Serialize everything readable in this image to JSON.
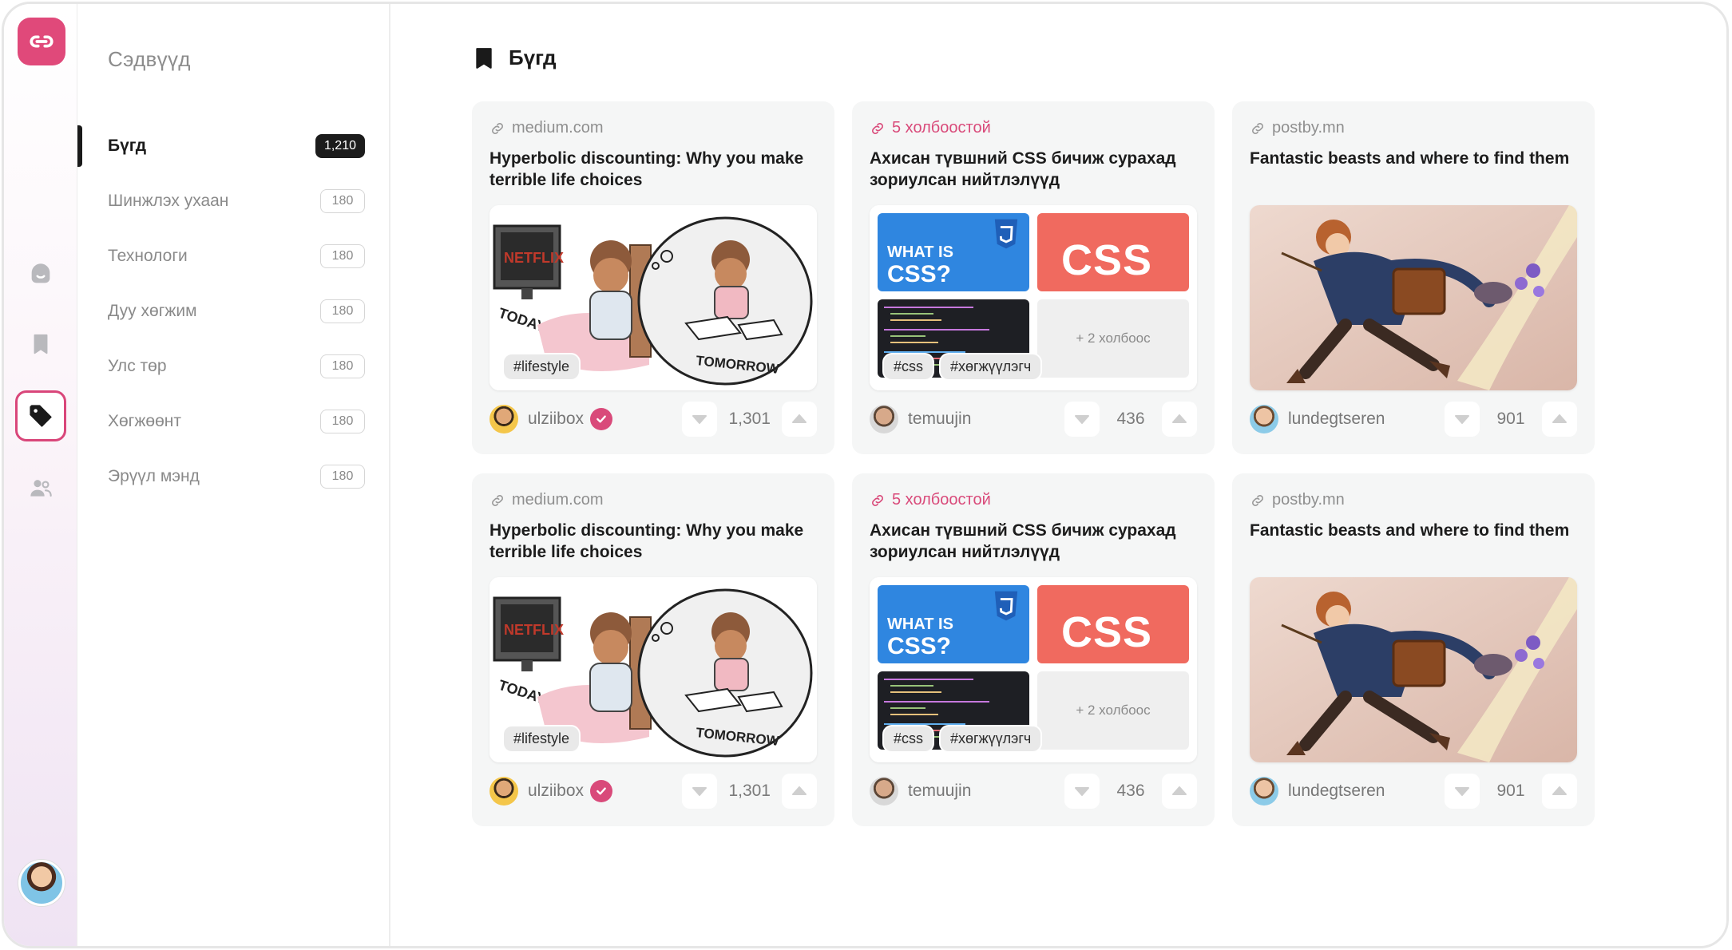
{
  "sidebar": {
    "title": "Сэдвүүд",
    "categories": [
      {
        "label": "Бүгд",
        "count": "1,210",
        "active": true
      },
      {
        "label": "Шинжлэх ухаан",
        "count": "180"
      },
      {
        "label": "Технологи",
        "count": "180"
      },
      {
        "label": "Дуу хөгжим",
        "count": "180"
      },
      {
        "label": "Улс төр",
        "count": "180"
      },
      {
        "label": "Хөгжөөнт",
        "count": "180"
      },
      {
        "label": "Эрүүл мэнд",
        "count": "180"
      }
    ]
  },
  "main": {
    "title": "Бүгд"
  },
  "cards": [
    {
      "source": "medium.com",
      "title": "Hyperbolic discounting: Why you make terrible life choices",
      "tags": [
        "#lifestyle"
      ],
      "user": "ulziibox",
      "votes": "1,301"
    },
    {
      "source": "5 холбоостой",
      "title": "Ахисан түвшний CSS бичиж сурахад зориулсан нийтлэлүүд",
      "tags": [
        "#css",
        "#хөгжүүлэгч"
      ],
      "more": "+ 2 холбоос",
      "tile_what_is": "WHAT IS",
      "tile_css_q": "CSS?",
      "tile_css": "CSS",
      "user": "temuujin",
      "votes": "436"
    },
    {
      "source": "postby.mn",
      "title": "Fantastic beasts and where to find them",
      "tags": [],
      "user": "lundegtseren",
      "votes": "901"
    },
    {
      "source": "medium.com",
      "title": "Hyperbolic discounting: Why you make terrible life choices",
      "tags": [
        "#lifestyle"
      ],
      "user": "ulziibox",
      "votes": "1,301"
    },
    {
      "source": "5 холбоостой",
      "title": "Ахисан түвшний CSS бичиж сурахад зориулсан нийтлэлүүд",
      "tags": [
        "#css",
        "#хөгжүүлэгч"
      ],
      "more": "+ 2 холбоос",
      "tile_what_is": "WHAT IS",
      "tile_css_q": "CSS?",
      "tile_css": "CSS",
      "user": "temuujin",
      "votes": "436"
    },
    {
      "source": "postby.mn",
      "title": "Fantastic beasts and where to find them",
      "tags": [],
      "user": "lundegtseren",
      "votes": "901"
    }
  ],
  "colors": {
    "accent": "#e0497a",
    "active_count_bg": "#1c1c1c",
    "card_bg": "#f5f6f6"
  },
  "icons": [
    "link-logo-icon",
    "home-icon",
    "bookmark-icon",
    "tag-icon",
    "users-icon",
    "link-icon",
    "verified-icon",
    "downvote-icon",
    "upvote-icon"
  ]
}
